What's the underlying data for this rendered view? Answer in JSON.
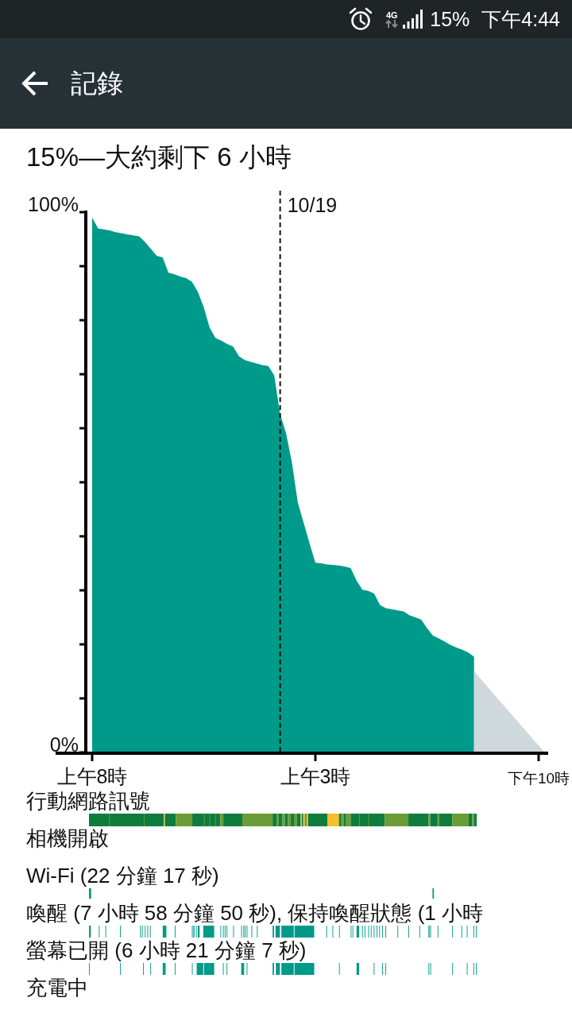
{
  "status_bar": {
    "network_type": "4G",
    "battery": "15%",
    "time": "下午4:44"
  },
  "app_bar": {
    "title": "記錄"
  },
  "summary": "15%—大約剩下 6 小時",
  "chart": {
    "chart_data": {
      "type": "area",
      "categories": [
        null,
        "上午8時",
        null,
        null,
        null,
        null,
        null,
        null,
        null,
        null,
        null,
        null,
        null,
        null,
        null,
        null,
        null,
        null,
        null,
        null,
        null,
        null,
        null,
        null,
        null,
        null,
        null,
        null,
        null,
        null,
        null,
        null,
        null,
        null,
        null,
        null,
        null,
        null,
        null,
        "上午3時",
        null,
        null,
        null,
        null,
        null,
        null,
        null,
        null,
        null,
        null,
        null,
        null,
        null,
        null,
        null,
        null,
        null,
        null,
        null,
        null,
        null,
        null,
        null,
        null,
        null,
        null,
        null,
        null,
        null,
        null,
        null,
        null,
        null,
        null,
        null,
        null,
        null,
        "下午10時",
        null
      ],
      "series": [
        {
          "color": "#009a8a",
          "values": [
            null,
            99.0,
            97.0,
            96.8,
            96.6,
            96.3,
            96.1,
            95.9,
            95.7,
            95.5,
            94.5,
            93.2,
            91.9,
            91.6,
            88.8,
            88.5,
            88.1,
            87.8,
            87.1,
            85.2,
            82.4,
            78.6,
            76.7,
            76.2,
            75.6,
            75.1,
            73.3,
            72.6,
            72.3,
            72.0,
            71.7,
            71.5,
            69.8,
            62.6,
            59.1,
            53.7,
            46.3,
            42.5,
            38.7,
            35.1,
            35.0,
            34.8,
            34.7,
            34.6,
            34.4,
            34.1,
            31.8,
            30.1,
            29.9,
            29.4,
            27.3,
            26.7,
            26.5,
            26.3,
            26.1,
            25.4,
            25.0,
            24.6,
            23.0,
            21.6,
            21.1,
            20.5,
            19.9,
            19.4,
            19.0,
            18.5,
            17.7,
            null,
            null,
            null,
            null,
            null,
            null,
            null,
            null,
            null,
            null,
            null,
            null
          ]
        },
        {
          "color": "#cfd8dc",
          "values": [
            null,
            null,
            null,
            null,
            null,
            null,
            null,
            null,
            null,
            null,
            null,
            null,
            null,
            null,
            null,
            null,
            null,
            null,
            null,
            null,
            null,
            null,
            null,
            null,
            null,
            null,
            null,
            null,
            null,
            null,
            null,
            null,
            null,
            null,
            null,
            null,
            null,
            null,
            null,
            null,
            null,
            null,
            null,
            null,
            null,
            null,
            null,
            null,
            null,
            null,
            null,
            null,
            null,
            null,
            null,
            null,
            null,
            null,
            null,
            null,
            null,
            null,
            null,
            null,
            null,
            null,
            15.0,
            13.8,
            12.5,
            11.3,
            10.0,
            8.8,
            7.5,
            6.3,
            5.0,
            3.8,
            2.5,
            1.3,
            0
          ]
        }
      ],
      "ylim": [
        0,
        100
      ],
      "yticks": [
        {
          "value": 0,
          "label": "0%"
        },
        {
          "value": 100,
          "label": "100%"
        }
      ],
      "annotations": [
        "10/19"
      ]
    }
  },
  "events": [
    {
      "kind": "signal",
      "label": "行動網路訊號"
    },
    {
      "kind": "camera",
      "label": "相機開啟"
    },
    {
      "kind": "wifi",
      "label": "Wi-Fi (22 分鐘 17 秒)"
    },
    {
      "kind": "awake",
      "label": "喚醒 (7 小時 58 分鐘 50 秒), 保持喚醒狀態 (1 小時"
    },
    {
      "kind": "screen",
      "label": "螢幕已開 (6 小時 21 分鐘 7 秒)"
    },
    {
      "kind": "charging",
      "label": "充電中"
    }
  ]
}
